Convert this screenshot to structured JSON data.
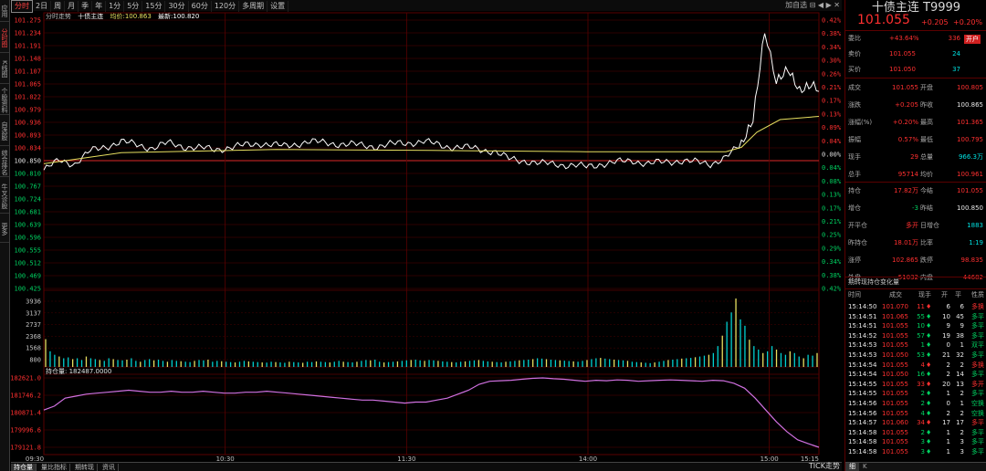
{
  "left_tabs": [
    {
      "label": "应用",
      "active": false
    },
    {
      "label": "分时图",
      "active": true
    },
    {
      "label": "K线图",
      "active": false
    },
    {
      "label": "个股资料",
      "active": false
    },
    {
      "label": "自选股",
      "active": false
    },
    {
      "label": "综合排名",
      "active": false
    },
    {
      "label": "牛叉诊股",
      "active": false
    },
    {
      "label": "更多",
      "active": false
    }
  ],
  "period_tabs": [
    {
      "label": "分时",
      "active": true
    },
    {
      "label": "2日"
    },
    {
      "label": "周"
    },
    {
      "label": "月"
    },
    {
      "label": "季"
    },
    {
      "label": "年"
    },
    {
      "label": "1分"
    },
    {
      "label": "5分"
    },
    {
      "label": "15分"
    },
    {
      "label": "30分"
    },
    {
      "label": "60分"
    },
    {
      "label": "120分"
    },
    {
      "label": "多周期"
    },
    {
      "label": "设置"
    }
  ],
  "right_controls": "加自选 ⊟ ◀ ▶ ✕",
  "info": {
    "label": "分时走势",
    "name": "十债主连",
    "avg_label": "均价:",
    "avg": "100.863",
    "last_label": "最新:",
    "last": "100.820"
  },
  "price_axis_left": [
    "101.275",
    "101.234",
    "101.191",
    "101.148",
    "101.107",
    "101.065",
    "101.022",
    "100.979",
    "100.936",
    "100.893",
    "100.834",
    "100.850",
    "100.810",
    "100.767",
    "100.724",
    "100.681",
    "100.639",
    "100.596",
    "100.555",
    "100.512",
    "100.469",
    "100.425"
  ],
  "pct_axis_right": [
    "0.42%",
    "0.38%",
    "0.34%",
    "0.30%",
    "0.26%",
    "0.21%",
    "0.17%",
    "0.13%",
    "0.09%",
    "0.04%",
    "0.00%",
    "0.04%",
    "0.08%",
    "0.13%",
    "0.17%",
    "0.21%",
    "0.25%",
    "0.29%",
    "0.34%",
    "0.38%",
    "0.42%"
  ],
  "vol_axis": [
    "3936",
    "3137",
    "2737",
    "2368",
    "1568",
    "800"
  ],
  "oi_label": "持仓量: 182487.0000",
  "oi_axis": [
    "182621.0",
    "181746.2",
    "180871.4",
    "179996.6",
    "179121.8"
  ],
  "time_axis": [
    "09:30",
    "10:30",
    "11:30",
    "14:00",
    "15:00",
    "15:15"
  ],
  "bottom_tabs": [
    {
      "label": "持仓量",
      "active": true
    },
    {
      "label": "量比指标"
    },
    {
      "label": "期转现"
    },
    {
      "label": "资讯"
    }
  ],
  "tick_label": "TICK走势",
  "colors": {
    "price": "#ffffff",
    "avg": "#e8e060",
    "oi": "#d070e0",
    "grid": "#5a0000",
    "up": "#ff3030",
    "down": "#00d060"
  },
  "chart_data": {
    "type": "line",
    "title": "分时走势",
    "x": [
      "09:30",
      "10:30",
      "11:30",
      "14:00",
      "15:00",
      "15:15"
    ],
    "ylim": [
      100.425,
      101.275
    ],
    "prev_settle": 100.85,
    "series": [
      {
        "name": "最新",
        "values": [
          [
            0,
            100.8
          ],
          [
            0.02,
            100.83
          ],
          [
            0.04,
            100.82
          ],
          [
            0.06,
            100.86
          ],
          [
            0.08,
            100.875
          ],
          [
            0.1,
            100.89
          ],
          [
            0.12,
            100.88
          ],
          [
            0.14,
            100.87
          ],
          [
            0.16,
            100.885
          ],
          [
            0.18,
            100.875
          ],
          [
            0.2,
            100.87
          ],
          [
            0.22,
            100.865
          ],
          [
            0.25,
            100.875
          ],
          [
            0.28,
            100.885
          ],
          [
            0.31,
            100.875
          ],
          [
            0.34,
            100.89
          ],
          [
            0.37,
            100.885
          ],
          [
            0.4,
            100.88
          ],
          [
            0.43,
            100.875
          ],
          [
            0.46,
            100.885
          ],
          [
            0.49,
            100.89
          ],
          [
            0.52,
            100.875
          ],
          [
            0.55,
            100.87
          ],
          [
            0.58,
            100.86
          ],
          [
            0.6,
            100.835
          ],
          [
            0.62,
            100.83
          ],
          [
            0.64,
            100.82
          ],
          [
            0.66,
            100.82
          ],
          [
            0.68,
            100.815
          ],
          [
            0.7,
            100.81
          ],
          [
            0.72,
            100.82
          ],
          [
            0.74,
            100.825
          ],
          [
            0.76,
            100.83
          ],
          [
            0.78,
            100.82
          ],
          [
            0.8,
            100.825
          ],
          [
            0.82,
            100.83
          ],
          [
            0.84,
            100.825
          ],
          [
            0.86,
            100.82
          ],
          [
            0.88,
            100.84
          ],
          [
            0.9,
            100.88
          ],
          [
            0.915,
            100.96
          ],
          [
            0.93,
            101.24
          ],
          [
            0.945,
            101.08
          ],
          [
            0.96,
            101.12
          ],
          [
            0.975,
            101.05
          ],
          [
            0.99,
            101.07
          ],
          [
            1.0,
            101.055
          ]
        ]
      },
      {
        "name": "均价",
        "values": [
          [
            0,
            100.82
          ],
          [
            0.1,
            100.855
          ],
          [
            0.3,
            100.865
          ],
          [
            0.5,
            100.862
          ],
          [
            0.7,
            100.858
          ],
          [
            0.88,
            100.858
          ],
          [
            0.9,
            100.872
          ],
          [
            0.92,
            100.92
          ],
          [
            0.95,
            100.96
          ],
          [
            1.0,
            100.97
          ]
        ]
      }
    ],
    "volume": [
      1600,
      900,
      700,
      600,
      500,
      550,
      450,
      500,
      400,
      600,
      500,
      450,
      400,
      350,
      500,
      450,
      400,
      380,
      420,
      500,
      350,
      300,
      400,
      450,
      380,
      420,
      350,
      300,
      400,
      350,
      330,
      300,
      280,
      350,
      400,
      380,
      420,
      300,
      350,
      330,
      300,
      280,
      260,
      300,
      350,
      320,
      300,
      280,
      260,
      250,
      300,
      280,
      260,
      240,
      300,
      280,
      260,
      240,
      300,
      280,
      320,
      300,
      280,
      260,
      300,
      350,
      300,
      280,
      260,
      300,
      350,
      400,
      380,
      420,
      300,
      260,
      280,
      300,
      320,
      350,
      380,
      400,
      420,
      380,
      350,
      400,
      380,
      350,
      320,
      300,
      280,
      260,
      300,
      320,
      350,
      380,
      400,
      350,
      320,
      300,
      280,
      260,
      300,
      320,
      350,
      380,
      400,
      420,
      450,
      500,
      480,
      450,
      420,
      400,
      380,
      360,
      340,
      320,
      300,
      350,
      400,
      450,
      500,
      520,
      480,
      450,
      420,
      400,
      380,
      350,
      300,
      280,
      260,
      240,
      220,
      260,
      300,
      350,
      400,
      420,
      450,
      480,
      500,
      520,
      560,
      600,
      650,
      700,
      800,
      1200,
      1800,
      2600,
      3137,
      3936,
      2737,
      2368,
      1568,
      1200,
      1000,
      800,
      900,
      1200,
      1000,
      800,
      700,
      900,
      800,
      600,
      500,
      700,
      650,
      800
    ]
  },
  "oi_data": [
    181000,
    181200,
    181600,
    181700,
    181800,
    181850,
    181900,
    181950,
    182000,
    181950,
    181900,
    181900,
    181950,
    181900,
    181900,
    181950,
    181900,
    181850,
    181850,
    181900,
    181900,
    181950,
    181900,
    181850,
    181800,
    181750,
    181700,
    181650,
    181600,
    181550,
    181500,
    181500,
    181450,
    181400,
    181350,
    181400,
    181400,
    181500,
    181600,
    181800,
    182000,
    182300,
    182450,
    182480,
    182500,
    182550,
    182600,
    182621,
    182580,
    182550,
    182500,
    182450,
    182500,
    182480,
    182520,
    182500,
    182450,
    182480,
    182500,
    182520,
    182500,
    182480,
    182450,
    182500,
    182480,
    182350,
    182100,
    181600,
    181000,
    180400,
    179900,
    179500,
    179300,
    179121
  ],
  "right_panel": {
    "title": "十债主连 T9999",
    "price": "101.055",
    "change": "+0.205",
    "change_pct": "+0.20%",
    "rows": [
      {
        "l": "委比",
        "v": "+43.64%",
        "v2": "336",
        "badge": "开户"
      },
      {
        "l": "卖价",
        "v": "101.055",
        "v2": "24"
      },
      {
        "l": "买价",
        "v": "101.050",
        "v2": "37"
      }
    ],
    "stats": [
      [
        "成交",
        "101.055",
        "开盘",
        "100.805"
      ],
      [
        "涨跌",
        "+0.205",
        "昨收",
        "100.865"
      ],
      [
        "涨幅(%)",
        "+0.20%",
        "最高",
        "101.365"
      ],
      [
        "振幅",
        "0.57%",
        "最低",
        "100.795"
      ],
      [
        "现手",
        "29",
        "总量",
        "966.3万"
      ],
      [
        "总手",
        "95714",
        "均价",
        "100.961"
      ],
      [
        "持仓",
        "17.82万",
        "今结",
        "101.055"
      ],
      [
        "增仓",
        "-3",
        "昨结",
        "100.850"
      ],
      [
        "开平仓",
        "多开",
        "日增仓",
        "1883"
      ],
      [
        "昨持仓",
        "18.01万",
        "比率",
        "1:19"
      ],
      [
        "涨停",
        "102.865",
        "跌停",
        "98.835"
      ],
      [
        "外盘",
        "51032",
        "内盘",
        "44682"
      ]
    ],
    "ticks_title": "期转现持仓变化量",
    "ticks_header": [
      "时间",
      "成交",
      "现手",
      "开",
      "平",
      "性质"
    ],
    "ticks": [
      [
        "15:14:50",
        "101.070",
        "11",
        "6",
        "6",
        "多换",
        "u"
      ],
      [
        "15:14:51",
        "101.065",
        "55",
        "10",
        "45",
        "多平",
        "d"
      ],
      [
        "15:14:51",
        "101.055",
        "10",
        "9",
        "9",
        "多平",
        "d"
      ],
      [
        "15:14:52",
        "101.055",
        "57",
        "19",
        "38",
        "多平",
        "d"
      ],
      [
        "15:14:53",
        "101.055",
        "1",
        "0",
        "1",
        "双平",
        "d"
      ],
      [
        "15:14:53",
        "101.050",
        "53",
        "21",
        "32",
        "多平",
        "d"
      ],
      [
        "15:14:54",
        "101.055",
        "4",
        "2",
        "2",
        "多换",
        "u"
      ],
      [
        "15:14:54",
        "101.050",
        "16",
        "2",
        "14",
        "多平",
        "d"
      ],
      [
        "15:14:55",
        "101.055",
        "33",
        "20",
        "13",
        "多开",
        "u"
      ],
      [
        "15:14:55",
        "101.055",
        "2",
        "1",
        "2",
        "多平",
        "d"
      ],
      [
        "15:14:56",
        "101.055",
        "2",
        "0",
        "1",
        "空换",
        "d"
      ],
      [
        "15:14:56",
        "101.055",
        "4",
        "2",
        "2",
        "空换",
        "d"
      ],
      [
        "15:14:57",
        "101.060",
        "34",
        "17",
        "17",
        "多平",
        "u"
      ],
      [
        "15:14:58",
        "101.055",
        "2",
        "1",
        "2",
        "多平",
        "d"
      ],
      [
        "15:14:58",
        "101.055",
        "3",
        "1",
        "3",
        "多平",
        "d"
      ],
      [
        "15:14:58",
        "101.055",
        "3",
        "1",
        "3",
        "多平",
        "d"
      ]
    ],
    "bottom_tabs": [
      "细",
      "K"
    ]
  }
}
